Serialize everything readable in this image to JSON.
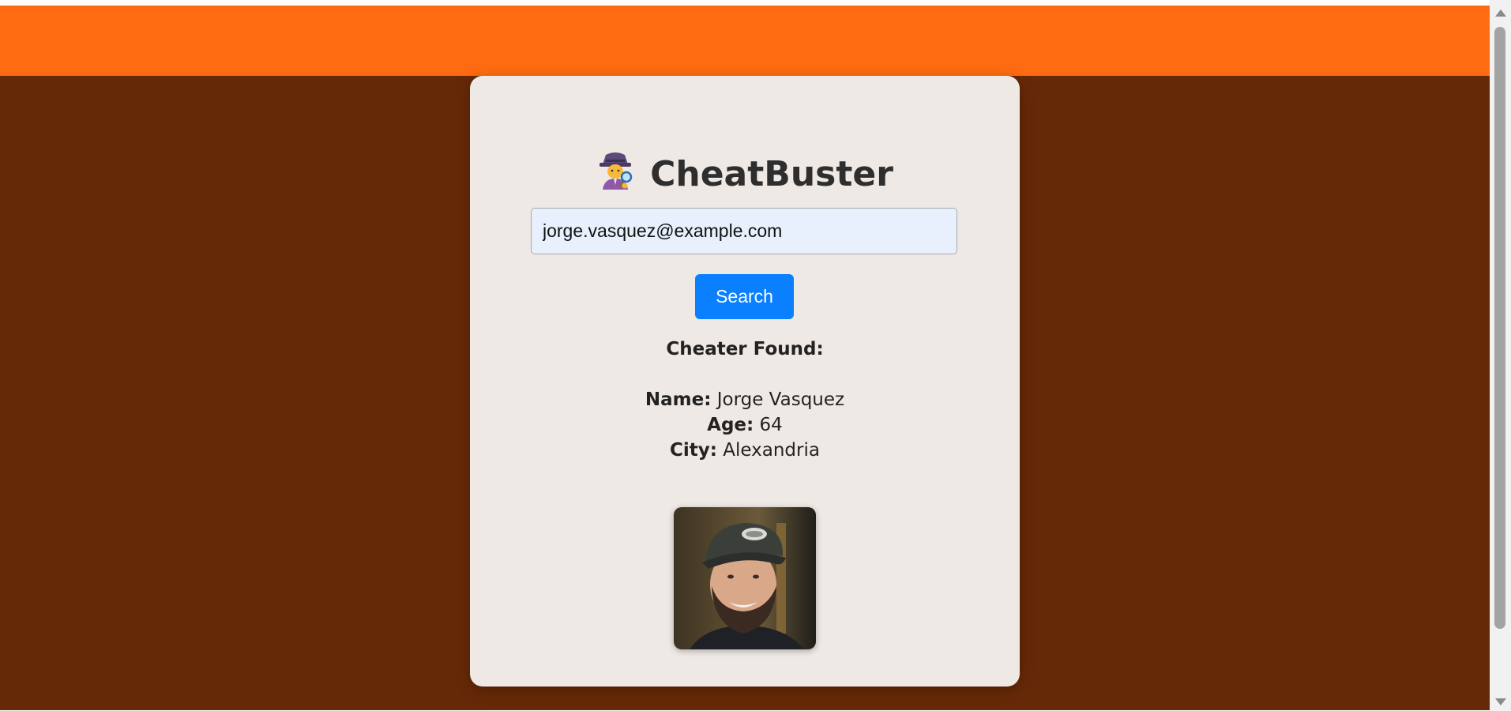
{
  "app": {
    "title": "CheatBuster",
    "title_icon": "detective-icon"
  },
  "search": {
    "value": "jorge.vasquez@example.com",
    "button_label": "Search"
  },
  "result": {
    "heading": "Cheater Found:",
    "name_label": "Name:",
    "name_value": "Jorge Vasquez",
    "age_label": "Age:",
    "age_value": "64",
    "city_label": "City:",
    "city_value": "Alexandria",
    "photo_icon": "profile-photo"
  },
  "colors": {
    "header": "#ff6b11",
    "background": "#662907",
    "card": "#efe9e5",
    "button": "#0a80ff",
    "input": "#e8f0fe"
  }
}
